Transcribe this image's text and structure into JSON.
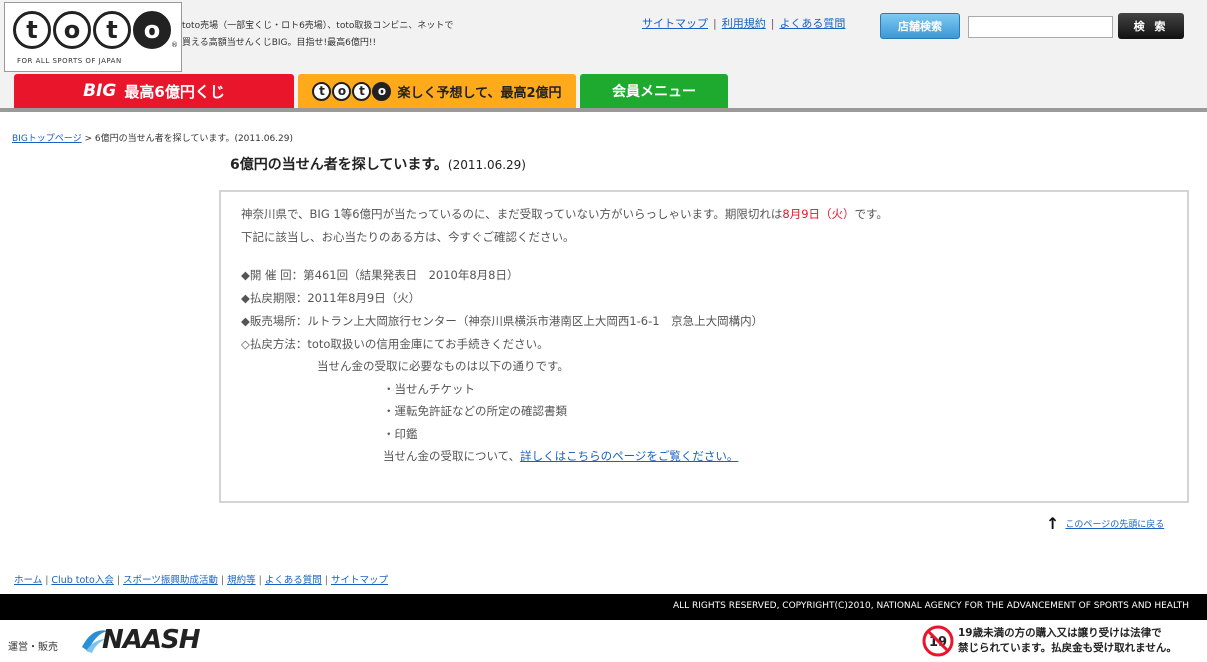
{
  "header": {
    "logo_letters": [
      "t",
      "o",
      "t",
      "o"
    ],
    "logo_tagline": "FOR ALL SPORTS OF JAPAN",
    "description_line1": "toto売場（一部宝くじ・ロト6売場）、toto取扱コンビニ、ネットで",
    "description_line2": "買える高額当せんくじBIG。目指せ!最高6億円!!",
    "top_links": [
      "サイトマップ",
      "利用規約",
      "よくある質問"
    ],
    "store_search_label": "店舗検索",
    "search_value": "",
    "search_button_label": "検 索",
    "tabs": {
      "big_prefix": "BIG",
      "big_label": "最高6億円くじ",
      "toto_label": "楽しく予想して、最高2億円",
      "member_label": "会員メニュー"
    }
  },
  "breadcrumb": {
    "home_link": "BIGトップページ",
    "separator": " > ",
    "current": "6億円の当せん者を探しています。(2011.06.29)"
  },
  "page": {
    "title": "6億円の当せん者を探しています。",
    "date": "(2011.06.29)"
  },
  "content": {
    "intro_pre": "神奈川県で、BIG 1等6億円が当たっているのに、まだ受取っていない方がいらっしゃいます。期限切れは",
    "intro_deadline": "8月9日（火）",
    "intro_post": "です。",
    "intro_line2": "下記に該当し、お心当たりのある方は、今すぐご確認ください。",
    "details": [
      "◆開 催 回：第461回（結果発表日　2010年8月8日）",
      "◆払戻期限：2011年8月9日（火）",
      "◆販売場所：ルトラン上大岡旅行センター（神奈川県横浜市港南区上大岡西1-6-1　京急上大岡構内）",
      "◇払戻方法：toto取扱いの信用金庫にてお手続きください。"
    ],
    "requirements_intro": "当せん金の受取に必要なものは以下の通りです。",
    "requirements": [
      "・当せんチケット",
      "・運転免許証などの所定の確認書類",
      "・印鑑"
    ],
    "more_pre": "当せん金の受取について、",
    "more_link": "詳しくはこちらのページをご覧ください。"
  },
  "to_top": "このページの先頭に戻る",
  "footer": {
    "links": [
      "ホーム",
      "Club toto入会",
      "スポーツ振興助成活動",
      "規約等",
      "よくある質問",
      "サイトマップ"
    ],
    "copyright": "ALL RIGHTS RESERVED, COPYRIGHT(C)2010, NATIONAL AGENCY FOR THE ADVANCEMENT OF SPORTS AND HEALTH",
    "operator_label": "運営・販売",
    "naash_logo": "NAASH",
    "age_icon_number": "19",
    "age_warning_line1": "19歳未満の方の購入又は譲り受けは法律で",
    "age_warning_line2": "禁じられています。払戻金も受け取れません。"
  },
  "colors": {
    "big_red": "#e8152b",
    "toto_orange": "#ffaa1a",
    "member_green": "#1eaa2e",
    "link_blue": "#1a62c0"
  }
}
